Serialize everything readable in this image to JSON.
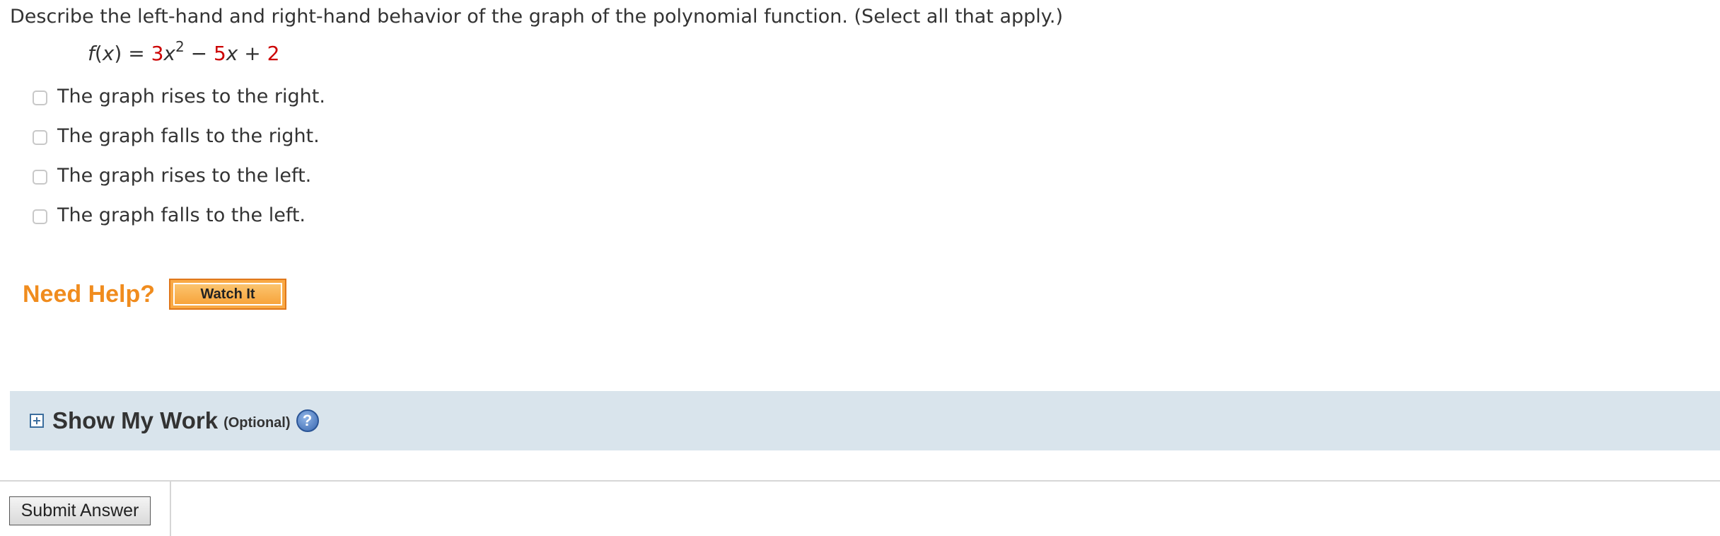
{
  "question": {
    "text": "Describe the left-hand and right-hand behavior of the graph of the polynomial function. (Select all that apply.)"
  },
  "equation": {
    "fname": "f",
    "open_paren": "(",
    "arg": "x",
    "close_eq": ") = ",
    "coef1": "3",
    "var1": "x",
    "exp1": "2",
    "op1": " − ",
    "coef2": "5",
    "var2": "x",
    "op2": " + ",
    "const": "2",
    "highlight_color": "#cc0000"
  },
  "options": [
    {
      "label": "The graph rises to the right.",
      "checked": false
    },
    {
      "label": "The graph falls to the right.",
      "checked": false
    },
    {
      "label": "The graph rises to the left.",
      "checked": false
    },
    {
      "label": "The graph falls to the left.",
      "checked": false
    }
  ],
  "help": {
    "label": "Need Help?",
    "watch_button": "Watch It",
    "color": "#f08c1e"
  },
  "show_my_work": {
    "title": "Show My Work",
    "optional": "(Optional)",
    "help_glyph": "?",
    "background": "#d9e4ec"
  },
  "submit": {
    "label": "Submit Answer"
  }
}
